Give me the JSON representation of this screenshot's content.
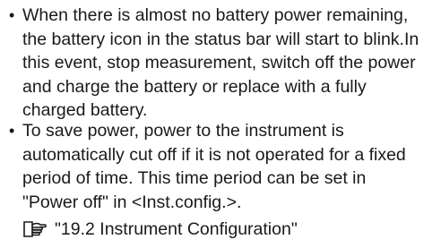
{
  "notes": [
    {
      "bullet": "•",
      "text": "When there is almost no battery power remaining,\nthe battery icon in the status bar will start to blink.In\nthis event, stop measurement, switch off the power\nand charge the battery or replace with a fully\ncharged battery."
    },
    {
      "bullet": "•",
      "text": "To save power, power to the instrument is\nautomatically cut off if it is not operated for a fixed\nperiod of time. This time period can be set in\n\"Power off\" in <Inst.config.>."
    }
  ],
  "reference": {
    "icon": "reference-pointer-icon",
    "text": "\"19.2 Instrument Configuration\""
  }
}
